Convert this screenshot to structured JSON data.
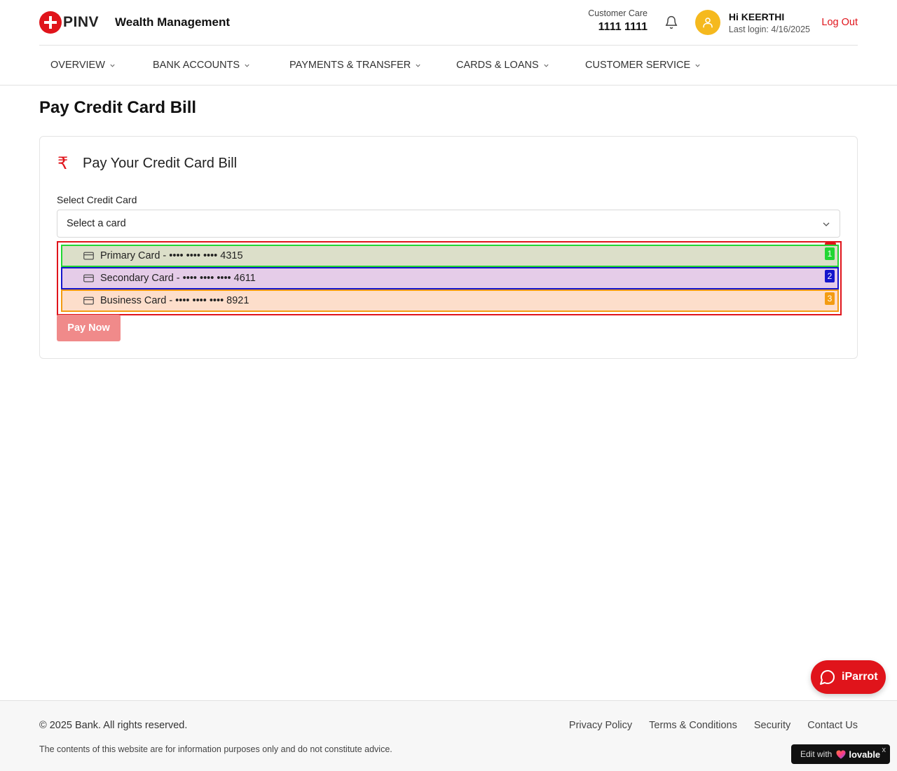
{
  "header": {
    "logo_text": "PINV",
    "brand_sub": "Wealth Management",
    "care_label": "Customer Care",
    "care_number": "1111 1111",
    "user_greeting": "Hi KEERTHI",
    "last_login": "Last login: 4/16/2025",
    "logout_label": "Log Out"
  },
  "nav": {
    "items": [
      {
        "label": "OVERVIEW"
      },
      {
        "label": "BANK ACCOUNTS"
      },
      {
        "label": "PAYMENTS & TRANSFER"
      },
      {
        "label": "CARDS & LOANS"
      },
      {
        "label": "CUSTOMER SERVICE"
      }
    ]
  },
  "page": {
    "title": "Pay Credit Card Bill",
    "card_title": "Pay Your Credit Card Bill",
    "rupee_symbol": "₹",
    "field_label": "Select Credit Card",
    "select_placeholder": "Select a card",
    "options": [
      {
        "label": "Primary Card - •••• •••• •••• 4315",
        "tag": "1"
      },
      {
        "label": "Secondary Card - •••• •••• •••• 4611",
        "tag": "2"
      },
      {
        "label": "Business Card - •••• •••• •••• 8921",
        "tag": "3"
      }
    ],
    "dropdown_tag": "0",
    "pay_button": "Pay Now"
  },
  "chat": {
    "label": "iParrot"
  },
  "footer": {
    "copyright": "© 2025 Bank. All rights reserved.",
    "disclaimer": "The contents of this website are for information purposes only and do not constitute advice.",
    "links": [
      "Privacy Policy",
      "Terms & Conditions",
      "Security",
      "Contact Us"
    ]
  },
  "badge": {
    "edit_with": "Edit with",
    "brand": "lovable",
    "close": "x"
  },
  "colors": {
    "brand_red": "#e0141b",
    "avatar_yellow": "#f5b91e",
    "button_disabled": "#f08a8a"
  }
}
